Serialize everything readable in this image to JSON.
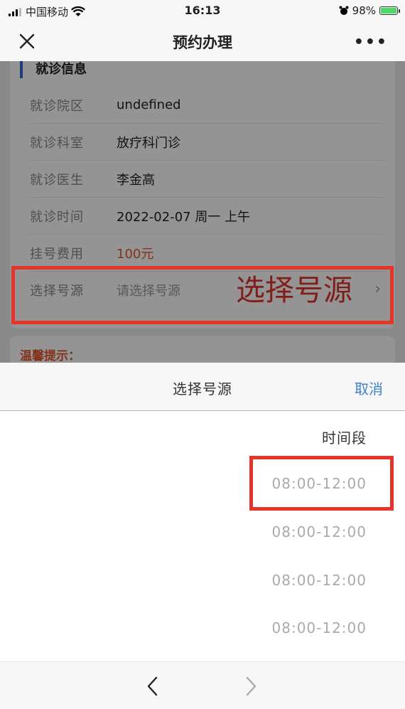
{
  "status_bar": {
    "carrier": "中国移动",
    "time": "16:13",
    "battery": "98%"
  },
  "nav": {
    "title": "预约办理",
    "more": "•••"
  },
  "visit_info": {
    "section_title": "就诊信息",
    "rows": [
      {
        "label": "就诊院区",
        "value": "undefined"
      },
      {
        "label": "就诊科室",
        "value": "放疗科门诊"
      },
      {
        "label": "就诊医生",
        "value": "李金高"
      },
      {
        "label": "就诊时间",
        "value": "2022-02-07 周一 上午"
      },
      {
        "label": "挂号费用",
        "value": "100元"
      },
      {
        "label": "选择号源",
        "value": "请选择号源"
      }
    ],
    "annotation": "选择号源"
  },
  "tips": {
    "title": "温馨提示："
  },
  "picker": {
    "title": "选择号源",
    "cancel": "取消",
    "column_header": "时间段",
    "slots": [
      "08:00-12:00",
      "08:00-12:00",
      "08:00-12:00",
      "08:00-12:00"
    ]
  },
  "colors": {
    "accent_blue": "#3d80cc",
    "fee_orange": "#e3582d",
    "annotation_red": "#e5342a",
    "section_bar": "#3a63d8"
  }
}
